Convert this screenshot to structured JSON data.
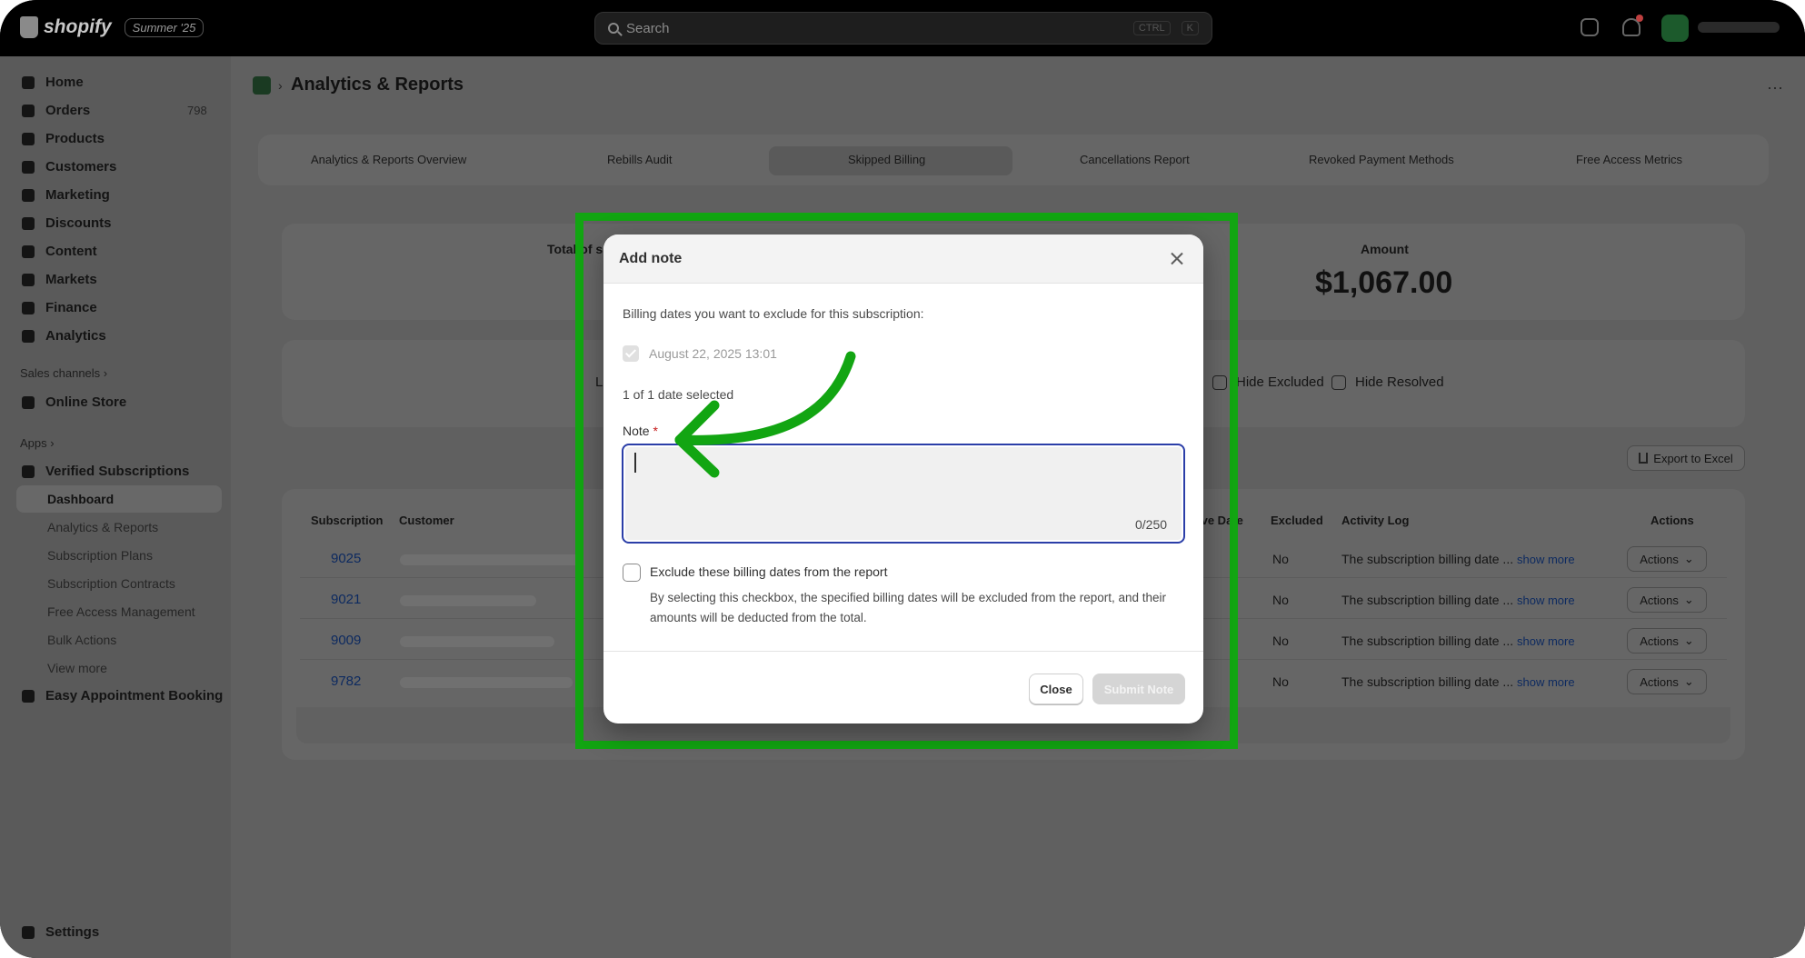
{
  "topbar": {
    "brand": "shopify",
    "edition": "Summer '25",
    "search_placeholder": "Search",
    "shortcut_ctrl": "CTRL",
    "shortcut_key": "K"
  },
  "sidebar": {
    "items": [
      {
        "label": "Home",
        "icon": "home-icon"
      },
      {
        "label": "Orders",
        "icon": "inbox-icon",
        "count": "798"
      },
      {
        "label": "Products",
        "icon": "tag-icon"
      },
      {
        "label": "Customers",
        "icon": "person-icon"
      },
      {
        "label": "Marketing",
        "icon": "target-icon"
      },
      {
        "label": "Discounts",
        "icon": "discount-icon"
      },
      {
        "label": "Content",
        "icon": "content-icon"
      },
      {
        "label": "Markets",
        "icon": "globe-icon"
      },
      {
        "label": "Finance",
        "icon": "bank-icon"
      },
      {
        "label": "Analytics",
        "icon": "chart-icon"
      }
    ],
    "sales_channels_label": "Sales channels",
    "online_store_label": "Online Store",
    "apps_label": "Apps",
    "app_name": "Verified Subscriptions",
    "app_subitems": [
      "Dashboard",
      "Analytics & Reports",
      "Subscription Plans",
      "Subscription Contracts",
      "Free Access Management",
      "Bulk Actions",
      "View more"
    ],
    "other_app": "Easy Appointment Booking",
    "settings_label": "Settings"
  },
  "page": {
    "title": "Analytics & Reports",
    "breadcrumb_sep": "›",
    "more": "···"
  },
  "tabs": [
    "Analytics & Reports Overview",
    "Rebills Audit",
    "Skipped Billing",
    "Cancellations Report",
    "Revoked Payment Methods",
    "Free Access Metrics"
  ],
  "stats": {
    "left_label": "Total of s",
    "amount_label": "Amount",
    "amount_value": "$1,067.00"
  },
  "filters": {
    "hide_excluded": "Hide Excluded",
    "hide_resolved": "Hide Resolved",
    "left_stub": "L"
  },
  "export_label": "Export to Excel",
  "table": {
    "headers": {
      "subscription": "Subscription",
      "customer": "Customer",
      "date_partial": "ive Date",
      "excluded": "Excluded",
      "activity_log": "Activity Log",
      "actions": "Actions"
    },
    "rows": [
      {
        "id": "9025",
        "excluded": "No",
        "log": "The subscription billing date ...",
        "more": "show more",
        "action": "Actions"
      },
      {
        "id": "9021",
        "excluded": "No",
        "log": "The subscription billing date ...",
        "more": "show more",
        "action": "Actions"
      },
      {
        "id": "9009",
        "excluded": "No",
        "log": "The subscription billing date ...",
        "more": "show more",
        "action": "Actions"
      },
      {
        "id": "9782",
        "excluded": "No",
        "log": "The subscription billing date ...",
        "more": "show more",
        "action": "Actions"
      }
    ]
  },
  "modal": {
    "title": "Add note",
    "intro": "Billing dates you want to exclude for this subscription:",
    "date_option": "August 22, 2025 13:01",
    "selected_count": "1 of 1 date selected",
    "note_label": "Note",
    "required_mark": "*",
    "note_value": "",
    "counter": "0/250",
    "exclude_label": "Exclude these billing dates from the report",
    "exclude_help": "By selecting this checkbox, the specified billing dates will be excluded from the report, and their amounts will be deducted from the total.",
    "close_label": "Close",
    "submit_label": "Submit Note"
  },
  "colors": {
    "highlight": "#12a512",
    "focus_ring": "#2b3ea8",
    "link": "#2c6ecb"
  }
}
